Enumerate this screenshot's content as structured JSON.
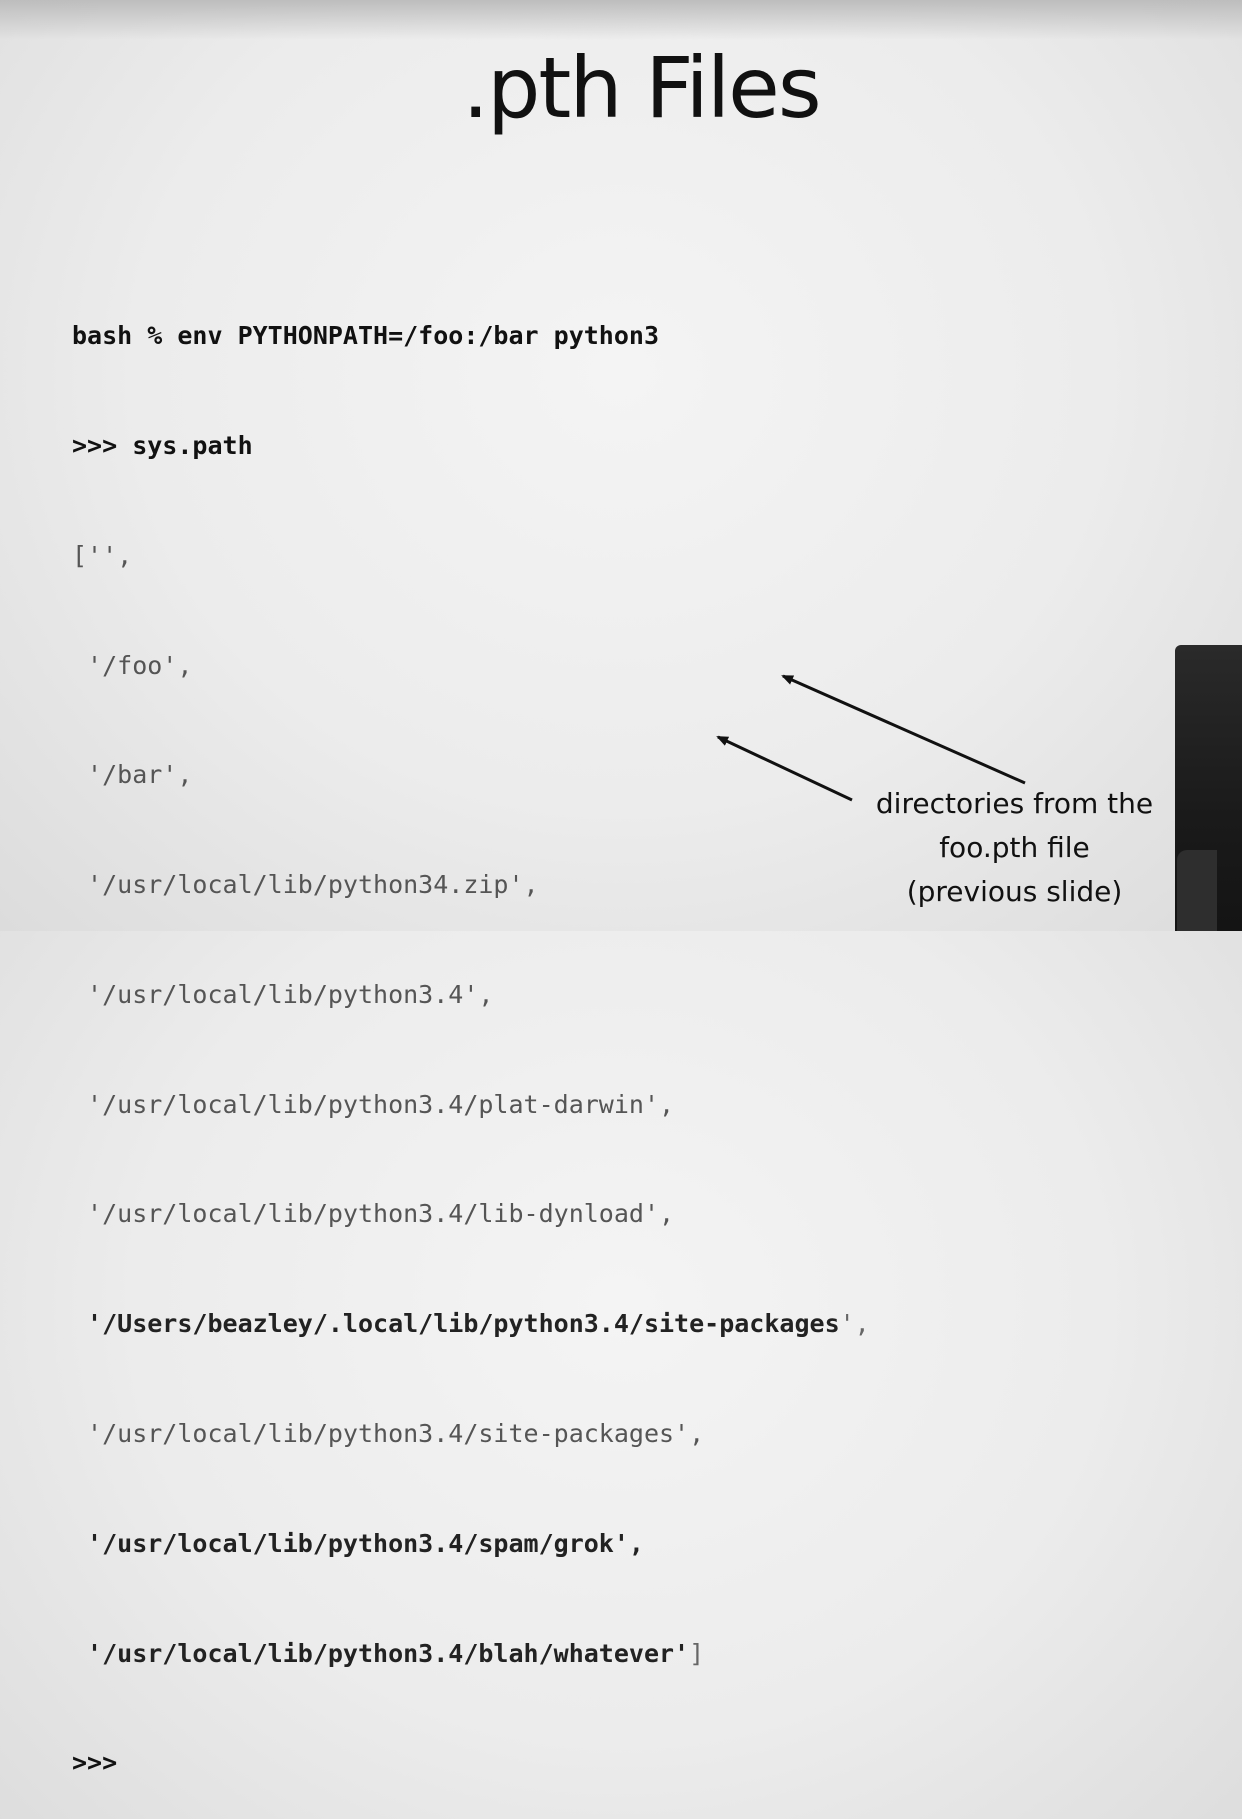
{
  "slide": {
    "title": ".pth Files",
    "code": {
      "shell_cmd": "bash % env PYTHONPATH=/foo:/bar python3",
      "prompt_cmd": ">>> sys.path",
      "lines": {
        "l1": "['',",
        "l2": " '/foo',",
        "l3": " '/bar',",
        "l4": " '/usr/local/lib/python34.zip',",
        "l5": " '/usr/local/lib/python3.4',",
        "l6": " '/usr/local/lib/python3.4/plat-darwin',",
        "l7": " '/usr/local/lib/python3.4/lib-dynload',",
        "l8_path": " '/Users/beazley/.local/lib/python3.4/site-packages",
        "l8_tail": "',",
        "l9": " '/usr/local/lib/python3.4/site-packages',",
        "l10": " '/usr/local/lib/python3.4/spam/grok',",
        "l11_path": " '/usr/local/lib/python3.4/blah/whatever'",
        "l11_tail": "]"
      },
      "final_prompt": ">>>"
    },
    "annotation": {
      "line1": "directories from the",
      "line2": "foo.pth file",
      "line3": "(previous slide)"
    }
  }
}
